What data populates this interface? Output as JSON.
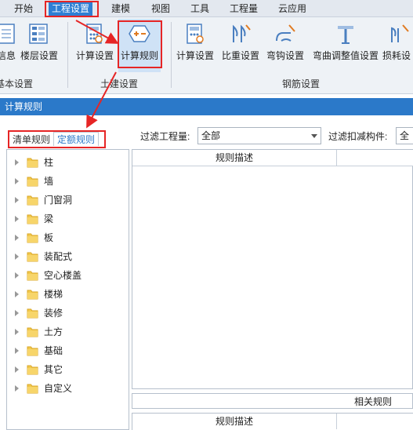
{
  "menu": {
    "items": [
      "开始",
      "工程设置",
      "建模",
      "视图",
      "工具",
      "工程量",
      "云应用"
    ],
    "active_index": 1
  },
  "ribbon": {
    "basic": {
      "buttons": [
        "信息",
        "楼层设置"
      ],
      "group_label": "基本设置"
    },
    "civil": {
      "buttons": [
        "计算设置",
        "计算规则"
      ],
      "group_label": "土建设置"
    },
    "rebar": {
      "buttons": [
        "计算设置",
        "比重设置",
        "弯钩设置",
        "弯曲调整值设置",
        "损耗设"
      ],
      "group_label": "钢筋设置"
    },
    "selected_button": "计算规则"
  },
  "dialog": {
    "title": "计算规则",
    "tabs": [
      "清单规则",
      "定额规则"
    ],
    "active_tab": 1,
    "filter_quantity_label": "过滤工程量:",
    "filter_quantity_value": "全部",
    "filter_deduct_label": "过滤扣减构件:",
    "filter_deduct_value": "全部"
  },
  "tree": {
    "items": [
      "柱",
      "墙",
      "门窗洞",
      "梁",
      "板",
      "装配式",
      "空心楼盖",
      "楼梯",
      "装修",
      "土方",
      "基础",
      "其它",
      "自定义"
    ]
  },
  "grid": {
    "upper_header": "规则描述",
    "related_label": "相关规则",
    "lower_header": "规则描述"
  },
  "colors": {
    "accent": "#2b79c9",
    "highlight": "#e62525",
    "folder": "#f2c94c"
  }
}
